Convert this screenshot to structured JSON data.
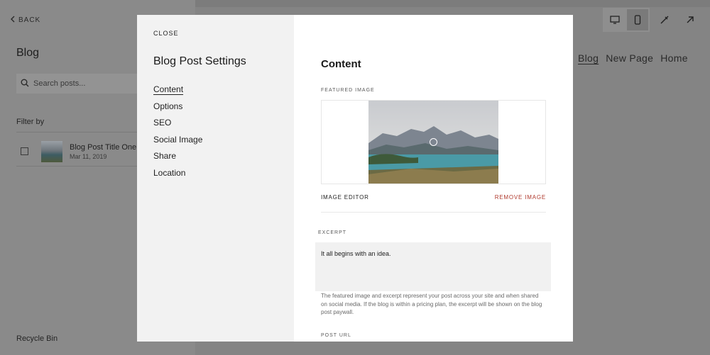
{
  "background": {
    "back_label": "BACK",
    "blog_title": "Blog",
    "search_placeholder": "Search posts...",
    "filter_label": "Filter by",
    "post": {
      "title": "Blog Post Title One",
      "date": "Mar 11, 2019"
    },
    "recycle_bin": "Recycle Bin",
    "site_nav": [
      "Blog",
      "New Page",
      "Home"
    ],
    "toolbar_icons": [
      "desktop-icon",
      "mobile-icon",
      "paintbrush-icon",
      "arrow-up-right-icon"
    ]
  },
  "modal": {
    "close_label": "CLOSE",
    "title": "Blog Post Settings",
    "nav": [
      "Content",
      "Options",
      "SEO",
      "Social Image",
      "Share",
      "Location"
    ],
    "active_nav": "Content",
    "content": {
      "heading": "Content",
      "featured_image_label": "FEATURED IMAGE",
      "image_editor_label": "IMAGE EDITOR",
      "remove_image_label": "REMOVE IMAGE",
      "excerpt_label": "EXCERPT",
      "excerpt_value": "It all begins with an idea.",
      "helper_text": "The featured image and excerpt represent your post across your site and when shared on social media. If the blog is within a pricing plan, the excerpt will be shown on the blog post paywall.",
      "post_url_label": "POST URL"
    }
  },
  "colors": {
    "remove_accent": "#b03a2e",
    "sidebar_bg": "#f2f2f2"
  }
}
